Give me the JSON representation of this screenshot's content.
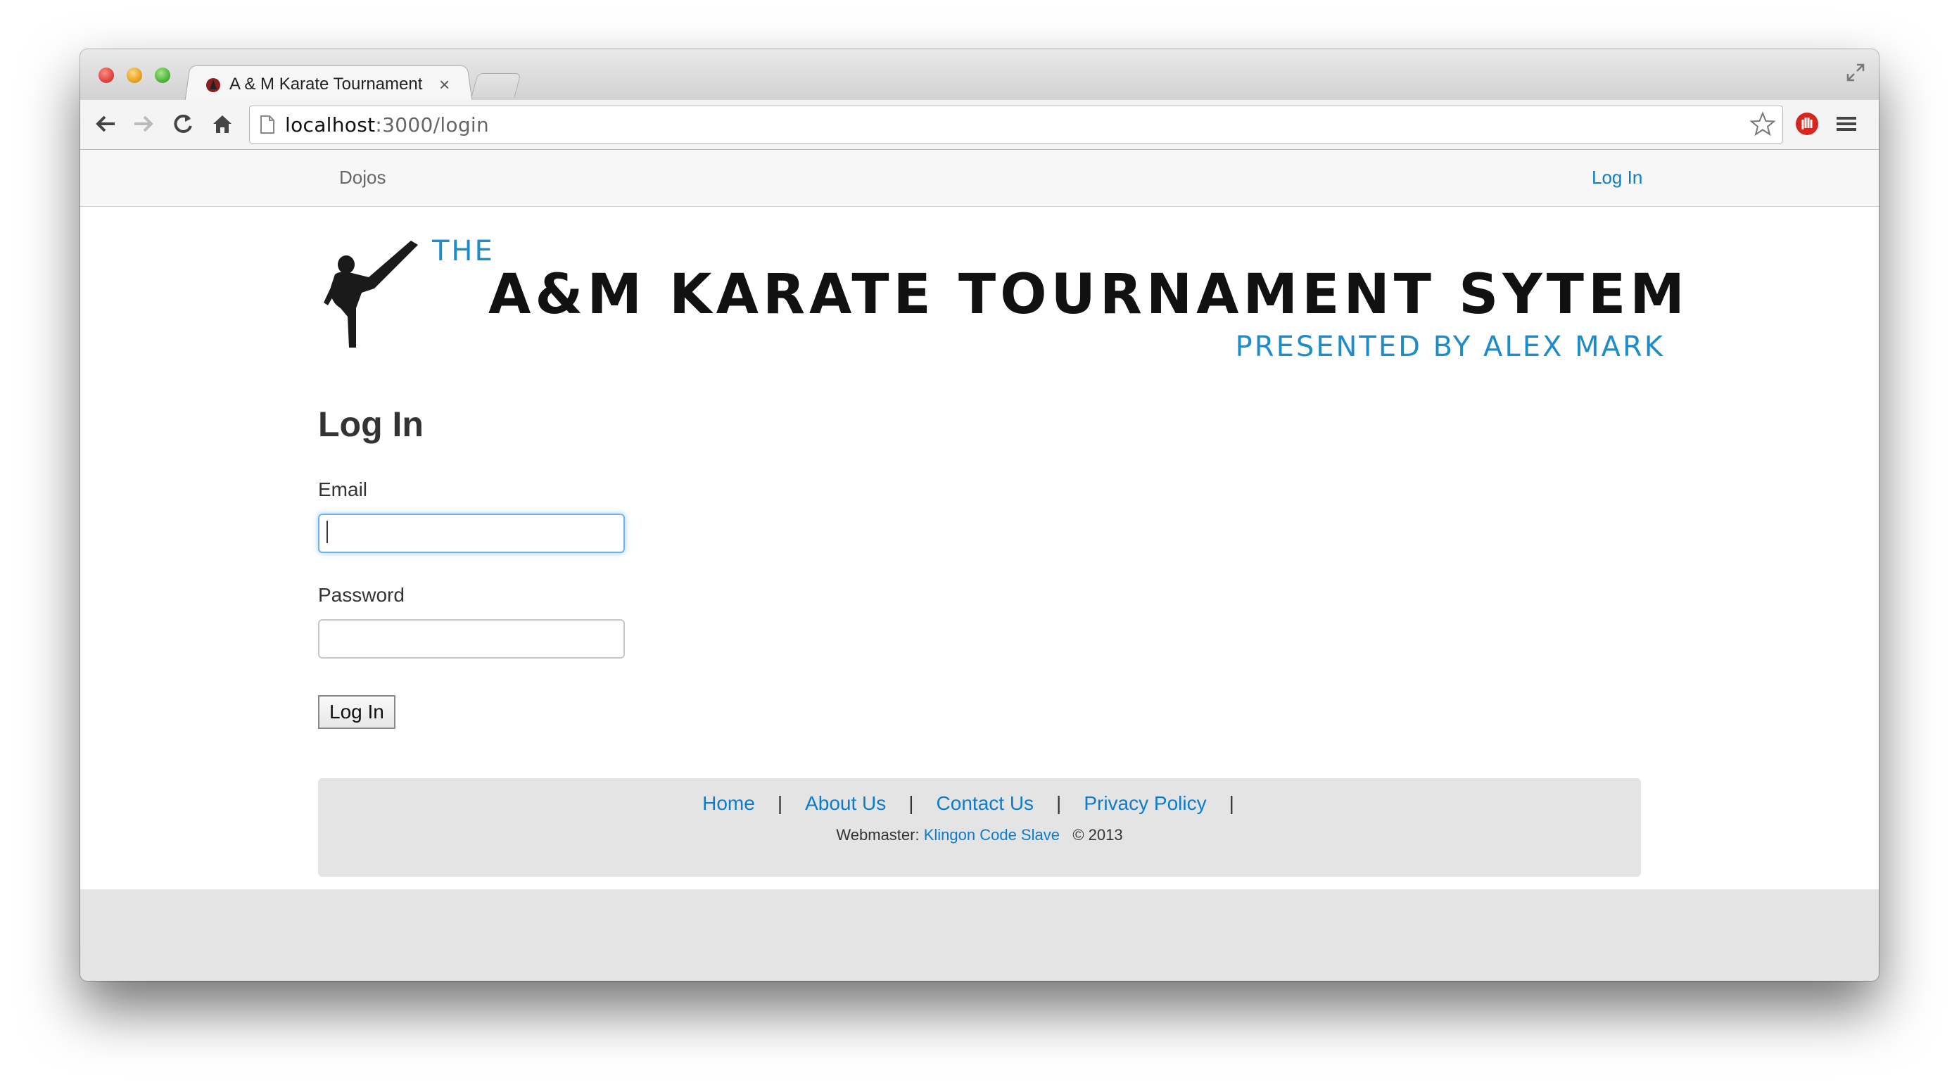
{
  "browser": {
    "tab_title": "A & M Karate Tournament",
    "tab_close": "×",
    "url_host": "localhost",
    "url_path": ":3000/login"
  },
  "navbar": {
    "left_link": "Dojos",
    "right_link": "Log In",
    "link_color": "#0c7ccb"
  },
  "banner": {
    "the": "THE",
    "title": "A&M KARATE TOURNAMENT SYTEM",
    "subtitle": "PRESENTED BY ALEX MARK",
    "accent_color": "#1d8ccb"
  },
  "form": {
    "heading": "Log In",
    "email_label": "Email",
    "email_value": "",
    "password_label": "Password",
    "password_value": "",
    "submit_label": "Log In"
  },
  "footer": {
    "links": [
      "Home",
      "About Us",
      "Contact Us",
      "Privacy Policy"
    ],
    "separator": "|",
    "webmaster_prefix": "Webmaster:",
    "webmaster_name": "Klingon Code Slave",
    "copyright": "© 2013"
  }
}
